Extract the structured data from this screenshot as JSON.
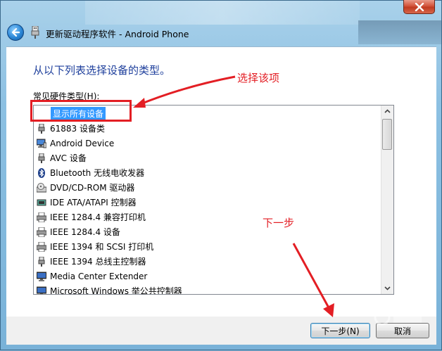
{
  "window": {
    "title": "更新驱动程序软件 - Android Phone"
  },
  "content": {
    "heading": "从以下列表选择设备的类型。",
    "list_label": "常见硬件类型(H):",
    "items": [
      {
        "label": "显示所有设备",
        "icon": "none",
        "selected": true
      },
      {
        "label": "61883 设备类",
        "icon": "usb-plug-icon"
      },
      {
        "label": "Android Device",
        "icon": "device-monitor-icon"
      },
      {
        "label": "AVC 设备",
        "icon": "usb-plug-icon"
      },
      {
        "label": "Bluetooth 无线电收发器",
        "icon": "bluetooth-icon"
      },
      {
        "label": "DVD/CD-ROM 驱动器",
        "icon": "disc-drive-icon"
      },
      {
        "label": "IDE ATA/ATAPI 控制器",
        "icon": "ide-controller-icon"
      },
      {
        "label": "IEEE 1284.4 兼容打印机",
        "icon": "printer-icon"
      },
      {
        "label": "IEEE 1284.4 设备",
        "icon": "printer-icon"
      },
      {
        "label": "IEEE 1394 和 SCSI 打印机",
        "icon": "printer-icon"
      },
      {
        "label": "IEEE 1394 总线主控制器",
        "icon": "usb-plug-icon"
      },
      {
        "label": "Media Center Extender",
        "icon": "monitor-icon"
      },
      {
        "label": "Microsoft Windows 举公共控制器",
        "icon": "monitor-icon"
      }
    ]
  },
  "footer": {
    "next_label": "下一步(N)",
    "cancel_label": "取消"
  },
  "annotations": {
    "select_hint": "选择该项",
    "next_hint": "下一步",
    "color": "#e31e24"
  }
}
